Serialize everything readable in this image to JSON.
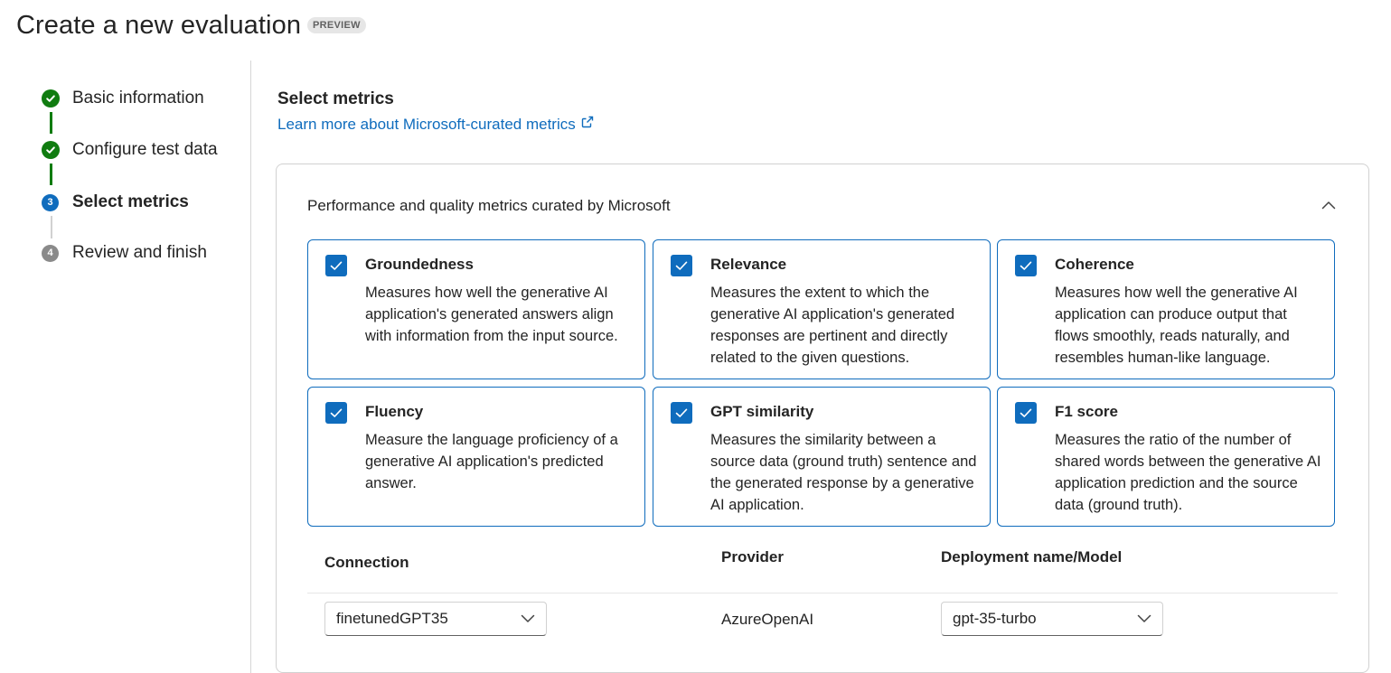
{
  "header": {
    "title": "Create a new evaluation",
    "badge": "PREVIEW"
  },
  "wizard": {
    "steps": [
      {
        "label": "Basic information",
        "state": "done",
        "number": "1"
      },
      {
        "label": "Configure test data",
        "state": "done",
        "number": "2"
      },
      {
        "label": "Select metrics",
        "state": "current",
        "number": "3"
      },
      {
        "label": "Review and finish",
        "state": "pending",
        "number": "4"
      }
    ]
  },
  "main": {
    "section_title": "Select metrics",
    "learn_more_link": "Learn more about Microsoft-curated metrics",
    "panel": {
      "title": "Performance and quality metrics curated by Microsoft",
      "expanded": true,
      "metrics": [
        {
          "name": "Groundedness",
          "checked": true,
          "description": "Measures how well the generative AI application's generated answers align with information from the input source."
        },
        {
          "name": "Relevance",
          "checked": true,
          "description": "Measures the extent to which the generative AI application's generated responses are pertinent and directly related to the given questions."
        },
        {
          "name": "Coherence",
          "checked": true,
          "description": "Measures how well the generative AI application can produce output that flows smoothly, reads naturally, and resembles human-like language."
        },
        {
          "name": "Fluency",
          "checked": true,
          "description": "Measure the language proficiency of a generative AI application's predicted answer."
        },
        {
          "name": "GPT similarity",
          "checked": true,
          "description": "Measures the similarity between a source data (ground truth) sentence and the generated response by a generative AI application."
        },
        {
          "name": "F1 score",
          "checked": true,
          "description": "Measures the ratio of the number of shared words between the generative AI application prediction and the source data (ground truth)."
        }
      ],
      "columns": {
        "connection": "Connection",
        "provider": "Provider",
        "deployment": "Deployment name/Model"
      },
      "values": {
        "connection": "finetunedGPT35",
        "provider": "AzureOpenAI",
        "deployment": "gpt-35-turbo"
      }
    }
  },
  "colors": {
    "accent": "#0f6cbd",
    "success": "#107c10",
    "pending": "#8a8a8a"
  }
}
